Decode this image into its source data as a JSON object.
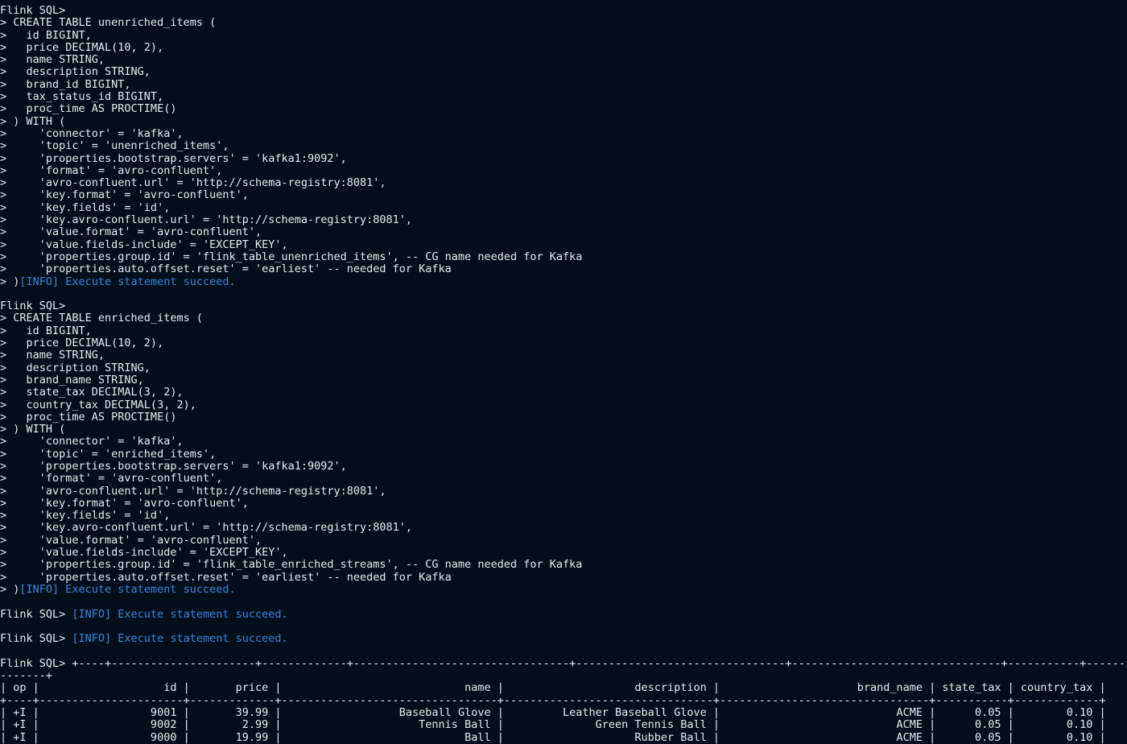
{
  "terminal": {
    "colors": {
      "background": "#020f1a",
      "text": "#e8ecef",
      "info": "#3a86e0"
    },
    "lines": [
      {
        "text": "Flink SQL>"
      },
      {
        "text": "> CREATE TABLE unenriched_items ("
      },
      {
        "text": ">   id BIGINT,"
      },
      {
        "text": ">   price DECIMAL(10, 2),"
      },
      {
        "text": ">   name STRING,"
      },
      {
        "text": ">   description STRING,"
      },
      {
        "text": ">   brand_id BIGINT,"
      },
      {
        "text": ">   tax_status_id BIGINT,"
      },
      {
        "text": ">   proc_time AS PROCTIME()"
      },
      {
        "text": "> ) WITH ("
      },
      {
        "text": ">     'connector' = 'kafka',"
      },
      {
        "text": ">     'topic' = 'unenriched_items',"
      },
      {
        "text": ">     'properties.bootstrap.servers' = 'kafka1:9092',"
      },
      {
        "text": ">     'format' = 'avro-confluent',"
      },
      {
        "text": ">     'avro-confluent.url' = 'http://schema-registry:8081',"
      },
      {
        "text": ">     'key.format' = 'avro-confluent',"
      },
      {
        "text": ">     'key.fields' = 'id',"
      },
      {
        "text": ">     'key.avro-confluent.url' = 'http://schema-registry:8081',"
      },
      {
        "text": ">     'value.format' = 'avro-confluent',"
      },
      {
        "text": ">     'value.fields-include' = 'EXCEPT_KEY',"
      },
      {
        "text": ">     'properties.group.id' = 'flink_table_unenriched_items', -- CG name needed for Kafka"
      },
      {
        "text": ">     'properties.auto.offset.reset' = 'earliest' -- needed for Kafka"
      },
      {
        "text": "> )",
        "info": "[INFO] Execute statement succeed."
      },
      {
        "text": ""
      },
      {
        "text": "Flink SQL>"
      },
      {
        "text": "> CREATE TABLE enriched_items ("
      },
      {
        "text": ">   id BIGINT,"
      },
      {
        "text": ">   price DECIMAL(10, 2),"
      },
      {
        "text": ">   name STRING,"
      },
      {
        "text": ">   description STRING,"
      },
      {
        "text": ">   brand_name STRING,"
      },
      {
        "text": ">   state_tax DECIMAL(3, 2),"
      },
      {
        "text": ">   country_tax DECIMAL(3, 2),"
      },
      {
        "text": ">   proc_time AS PROCTIME()"
      },
      {
        "text": "> ) WITH ("
      },
      {
        "text": ">     'connector' = 'kafka',"
      },
      {
        "text": ">     'topic' = 'enriched_items',"
      },
      {
        "text": ">     'properties.bootstrap.servers' = 'kafka1:9092',"
      },
      {
        "text": ">     'format' = 'avro-confluent',"
      },
      {
        "text": ">     'avro-confluent.url' = 'http://schema-registry:8081',"
      },
      {
        "text": ">     'key.format' = 'avro-confluent',"
      },
      {
        "text": ">     'key.fields' = 'id',"
      },
      {
        "text": ">     'key.avro-confluent.url' = 'http://schema-registry:8081',"
      },
      {
        "text": ">     'value.format' = 'avro-confluent',"
      },
      {
        "text": ">     'value.fields-include' = 'EXCEPT_KEY',"
      },
      {
        "text": ">     'properties.group.id' = 'flink_table_enriched_streams', -- CG name needed for Kafka"
      },
      {
        "text": ">     'properties.auto.offset.reset' = 'earliest' -- needed for Kafka"
      },
      {
        "text": "> )",
        "info": "[INFO] Execute statement succeed."
      },
      {
        "text": ""
      },
      {
        "text": "Flink SQL> ",
        "info": "[INFO] Execute statement succeed."
      },
      {
        "text": ""
      },
      {
        "text": "Flink SQL> ",
        "info": "[INFO] Execute statement succeed."
      },
      {
        "text": ""
      },
      {
        "text": "Flink SQL> +----+----------------------+-------------+---------------------------------+--------------------------------+--------------------------------+-----------+------------"
      },
      {
        "text": "-------+"
      },
      {
        "text": "| op |                   id |       price |                            name |                    description |                     brand_name | state_tax | country_tax |"
      },
      {
        "text": "+----+----------------------+-------------+---------------------------------+--------------------------------+--------------------------------+-----------+-------------+"
      },
      {
        "text": "| +I |                 9001 |       39.99 |                  Baseball Glove |         Leather Baseball Glove |                           ACME |      0.05 |        0.10 |"
      },
      {
        "text": "| +I |                 9002 |        2.99 |                     Tennis Ball |              Green Tennis Ball |                           ACME |      0.05 |        0.10 |"
      },
      {
        "text": "| +I |                 9000 |       19.99 |                            Ball |                    Rubber Ball |                           ACME |      0.05 |        0.10 |"
      }
    ]
  }
}
